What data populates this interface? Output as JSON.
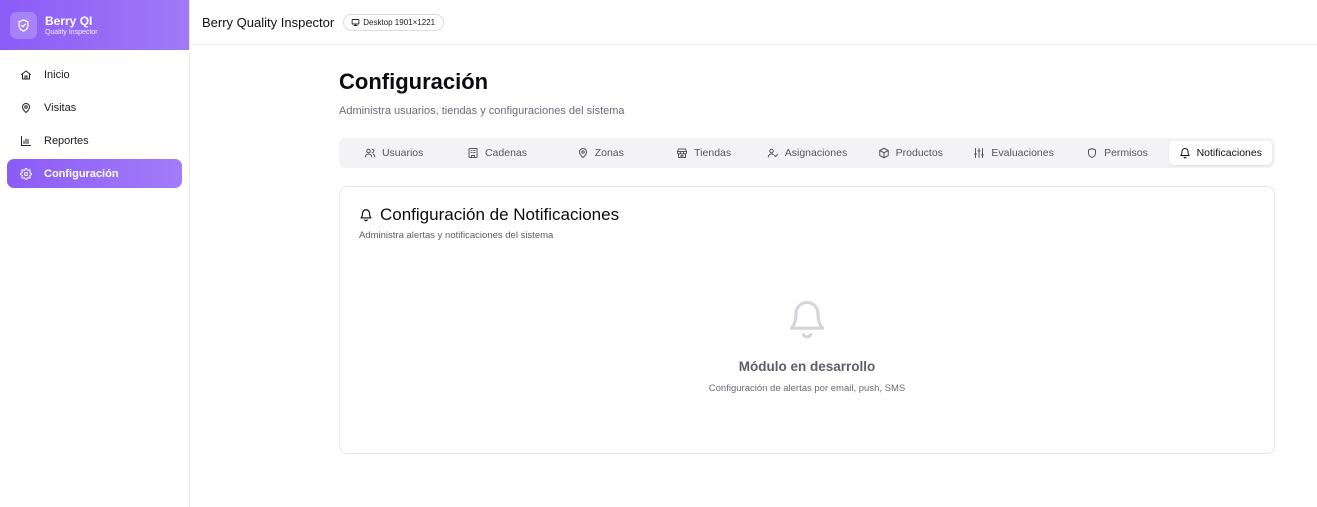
{
  "brand": {
    "title": "Berry QI",
    "subtitle": "Quality Inspector",
    "logo_icon": "shield-check-icon",
    "gradient_start": "#8b5cf6",
    "gradient_end": "#a07af7"
  },
  "sidebar": {
    "items": [
      {
        "label": "Inicio",
        "icon": "home-icon",
        "active": false
      },
      {
        "label": "Visitas",
        "icon": "map-pin-icon",
        "active": false
      },
      {
        "label": "Reportes",
        "icon": "bar-chart-icon",
        "active": false
      },
      {
        "label": "Configuración",
        "icon": "gear-icon",
        "active": true
      }
    ]
  },
  "header": {
    "title": "Berry Quality Inspector",
    "viewport_badge": "Desktop 1901×1221",
    "viewport_icon": "monitor-icon"
  },
  "main": {
    "title": "Configuración",
    "subtitle": "Administra usuarios, tiendas y configuraciones del sistema",
    "tabs": [
      {
        "label": "Usuarios",
        "icon": "users-icon",
        "active": false
      },
      {
        "label": "Cadenas",
        "icon": "buildings-icon",
        "active": false
      },
      {
        "label": "Zonas",
        "icon": "map-pin-icon",
        "active": false
      },
      {
        "label": "Tiendas",
        "icon": "store-icon",
        "active": false
      },
      {
        "label": "Asignaciones",
        "icon": "user-check-icon",
        "active": false
      },
      {
        "label": "Productos",
        "icon": "package-icon",
        "active": false
      },
      {
        "label": "Evaluaciones",
        "icon": "sliders-icon",
        "active": false
      },
      {
        "label": "Permisos",
        "icon": "shield-icon",
        "active": false
      },
      {
        "label": "Notificaciones",
        "icon": "bell-icon",
        "active": true
      }
    ],
    "card": {
      "title": "Configuración de Notificaciones",
      "subtitle": "Administra alertas y notificaciones del sistema",
      "empty_title": "Módulo en desarrollo",
      "empty_subtitle": "Configuración de alertas por email, push, SMS"
    }
  },
  "colors": {
    "accent": "#8b5cf6",
    "muted_text": "#6b6b76",
    "tab_bg": "#f3f3f6"
  }
}
